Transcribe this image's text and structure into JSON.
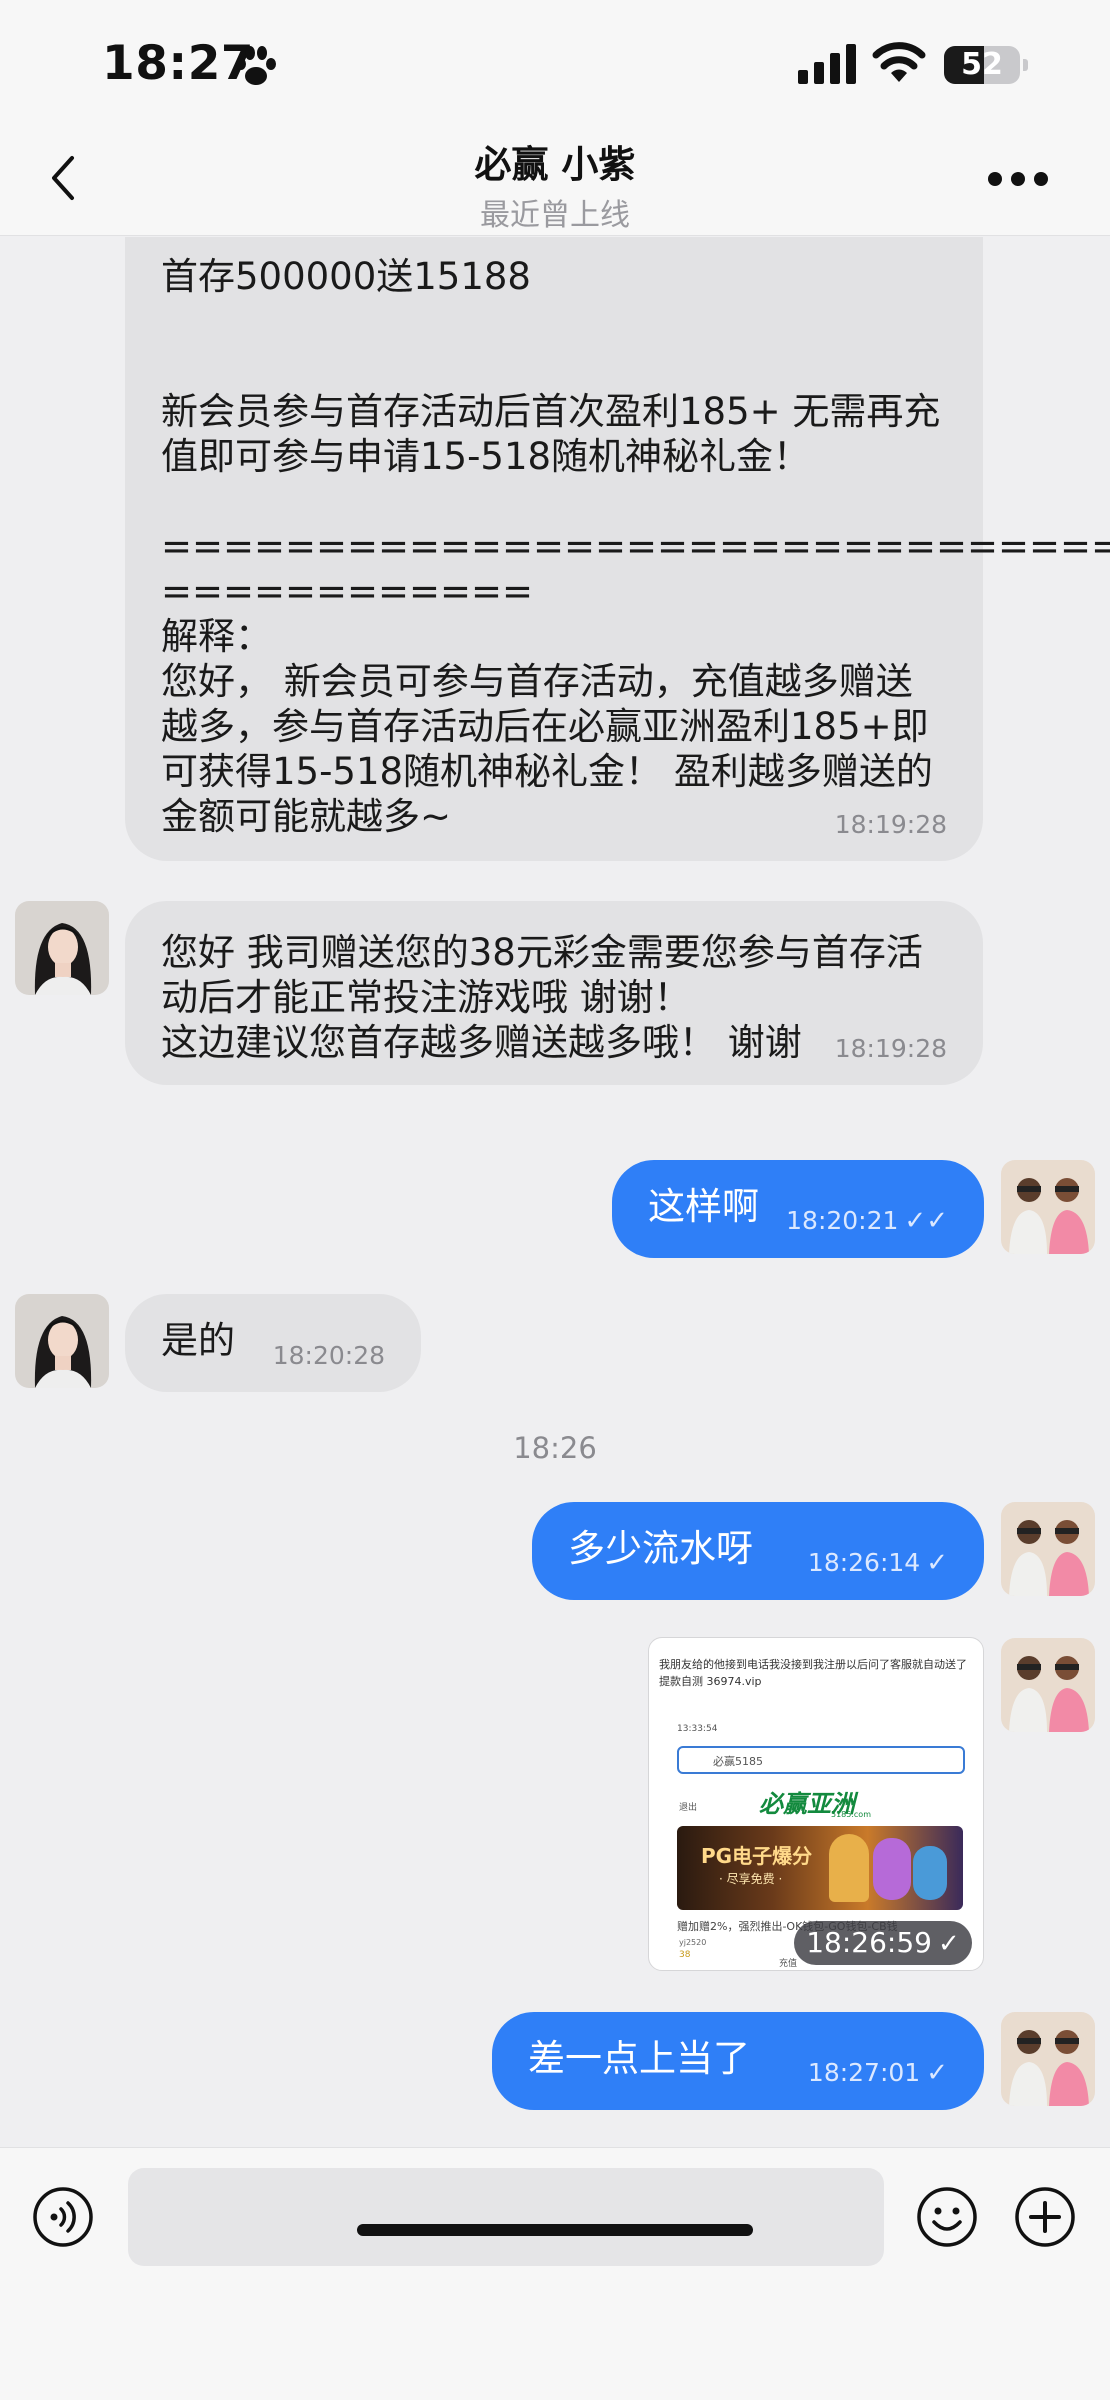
{
  "status_bar": {
    "time": "18:27",
    "battery": "52",
    "battery_level_percent": 52
  },
  "header": {
    "title": "必赢 小紫",
    "subtitle": "最近曾上线"
  },
  "messages": [
    {
      "from": "agent",
      "text": "首存500000送15188\n\n\n新会员参与首存活动后首次盈利185+ 无需再充值即可参与申请15-518随机神秘礼金！\n\n====================================\n============\n解释：\n您好， 新会员可参与首存活动，充值越多赠送越多，参与首存活动后在必赢亚洲盈利185+即可获得15-518随机神秘礼金！ 盈利越多赠送的金额可能就越多~",
      "time": "18:19:28"
    },
    {
      "from": "agent",
      "text": "您好 我司赠送您的38元彩金需要您参与首存活动后才能正常投注游戏哦 谢谢！\n这边建议您首存越多赠送越多哦！ 谢谢",
      "time": "18:19:28"
    },
    {
      "from": "me",
      "text": "这样啊",
      "time": "18:20:21",
      "status": "read"
    },
    {
      "from": "agent",
      "text": "是的",
      "time": "18:20:28"
    },
    {
      "from": "me",
      "text": "多少流水呀",
      "time": "18:26:14",
      "status": "sent"
    },
    {
      "from": "me",
      "type": "image",
      "time": "18:26:59",
      "status": "sent"
    },
    {
      "from": "me",
      "text": "差一点上当了",
      "time": "18:27:01",
      "status": "sent"
    }
  ],
  "separator_time": "18:26",
  "tick_single": "✓",
  "tick_double": "✓✓",
  "screenshot": {
    "caption": "我朋友给的他接到电话我没接到我注册以后问了客服就自动送了  提款自测  36974.vip",
    "status_time": "13:33:54",
    "search_value": "必赢5185",
    "exit_label": "退出",
    "brand": "必赢亚洲",
    "brand_sub": "5185.com",
    "banner_title": "PG电子爆分",
    "banner_sub": "· 尽享免费 ·",
    "ticker": "赠加赠2%，强烈推出-OK钱包-GO钱包-CB钱",
    "user": "yj2520",
    "balance": "38",
    "charge_label": "充值"
  },
  "colors": {
    "outgoing": "#2f7ff7",
    "incoming": "#e2e2e4",
    "background": "#efeff1"
  }
}
